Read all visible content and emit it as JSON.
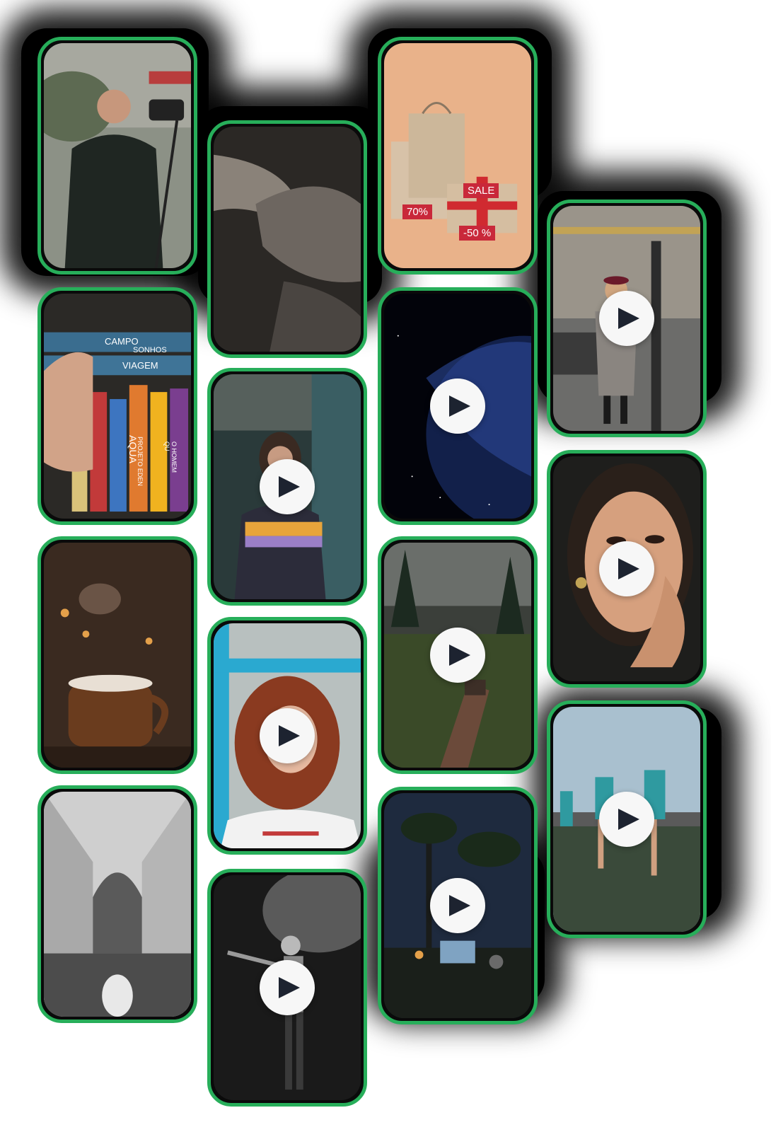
{
  "gallery": {
    "accent_color": "#27ae5a",
    "tiles": [
      {
        "name": "camera-operator-photo",
        "type": "image",
        "icon": null
      },
      {
        "name": "open-hands-photo",
        "type": "image",
        "icon": null
      },
      {
        "name": "sale-bags-photo",
        "type": "image",
        "icon": null,
        "labels": {
          "sale": "SALE",
          "bag_discount": "70%",
          "box_discount": "-50 %"
        }
      },
      {
        "name": "bookshelf-photo",
        "type": "image",
        "icon": null,
        "labels": {
          "book1": "CAMPO",
          "book2": "SONHOS",
          "book3": "VIAGEM",
          "book4": "AQUA",
          "book5": "PROJETO EDEN",
          "book6": "O HOMEM QU"
        }
      },
      {
        "name": "mirror-woman-video",
        "type": "video",
        "icon": "play-icon"
      },
      {
        "name": "earth-space-video",
        "type": "video",
        "icon": "play-icon"
      },
      {
        "name": "street-walk-video",
        "type": "video",
        "icon": "play-icon"
      },
      {
        "name": "cocoa-mug-photo",
        "type": "image",
        "icon": null
      },
      {
        "name": "red-hair-woman-video",
        "type": "video",
        "icon": "play-icon"
      },
      {
        "name": "forest-legs-video",
        "type": "video",
        "icon": "play-icon"
      },
      {
        "name": "portrait-woman-video",
        "type": "video",
        "icon": "play-icon"
      },
      {
        "name": "atrium-dog-photo",
        "type": "image",
        "icon": null
      },
      {
        "name": "stage-performer-video",
        "type": "video",
        "icon": "play-icon"
      },
      {
        "name": "night-camp-video",
        "type": "video",
        "icon": "play-icon"
      },
      {
        "name": "football-players-video",
        "type": "video",
        "icon": "play-icon"
      }
    ]
  }
}
